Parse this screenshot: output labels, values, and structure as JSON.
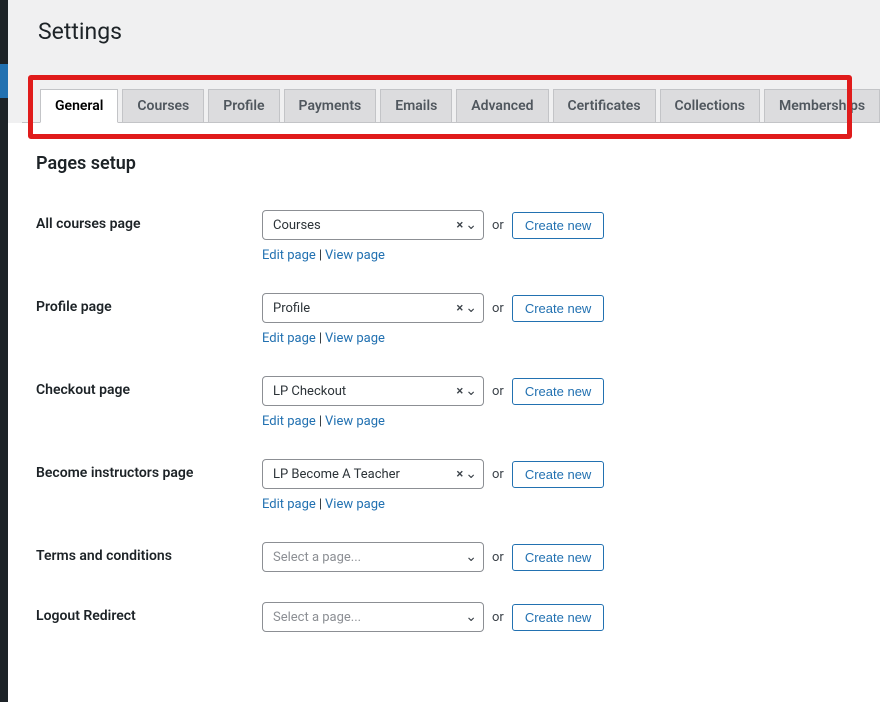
{
  "page_title": "Settings",
  "tabs": [
    {
      "label": "General",
      "active": true
    },
    {
      "label": "Courses",
      "active": false
    },
    {
      "label": "Profile",
      "active": false
    },
    {
      "label": "Payments",
      "active": false
    },
    {
      "label": "Emails",
      "active": false
    },
    {
      "label": "Advanced",
      "active": false
    },
    {
      "label": "Certificates",
      "active": false
    },
    {
      "label": "Collections",
      "active": false
    },
    {
      "label": "Memberships",
      "active": false
    }
  ],
  "section_title": "Pages setup",
  "or_text": "or",
  "create_new": "Create new",
  "edit_page": "Edit page",
  "view_page": "View page",
  "select_placeholder": "Select a page...",
  "fields": {
    "all_courses": {
      "label": "All courses page",
      "value": "Courses",
      "has_links": true
    },
    "profile": {
      "label": "Profile page",
      "value": "Profile",
      "has_links": true
    },
    "checkout": {
      "label": "Checkout page",
      "value": "LP Checkout",
      "has_links": true
    },
    "become_instructors": {
      "label": "Become instructors page",
      "value": "LP Become A Teacher",
      "has_links": true
    },
    "terms": {
      "label": "Terms and conditions",
      "value": "",
      "has_links": false
    },
    "logout": {
      "label": "Logout Redirect",
      "value": "",
      "has_links": false
    }
  }
}
